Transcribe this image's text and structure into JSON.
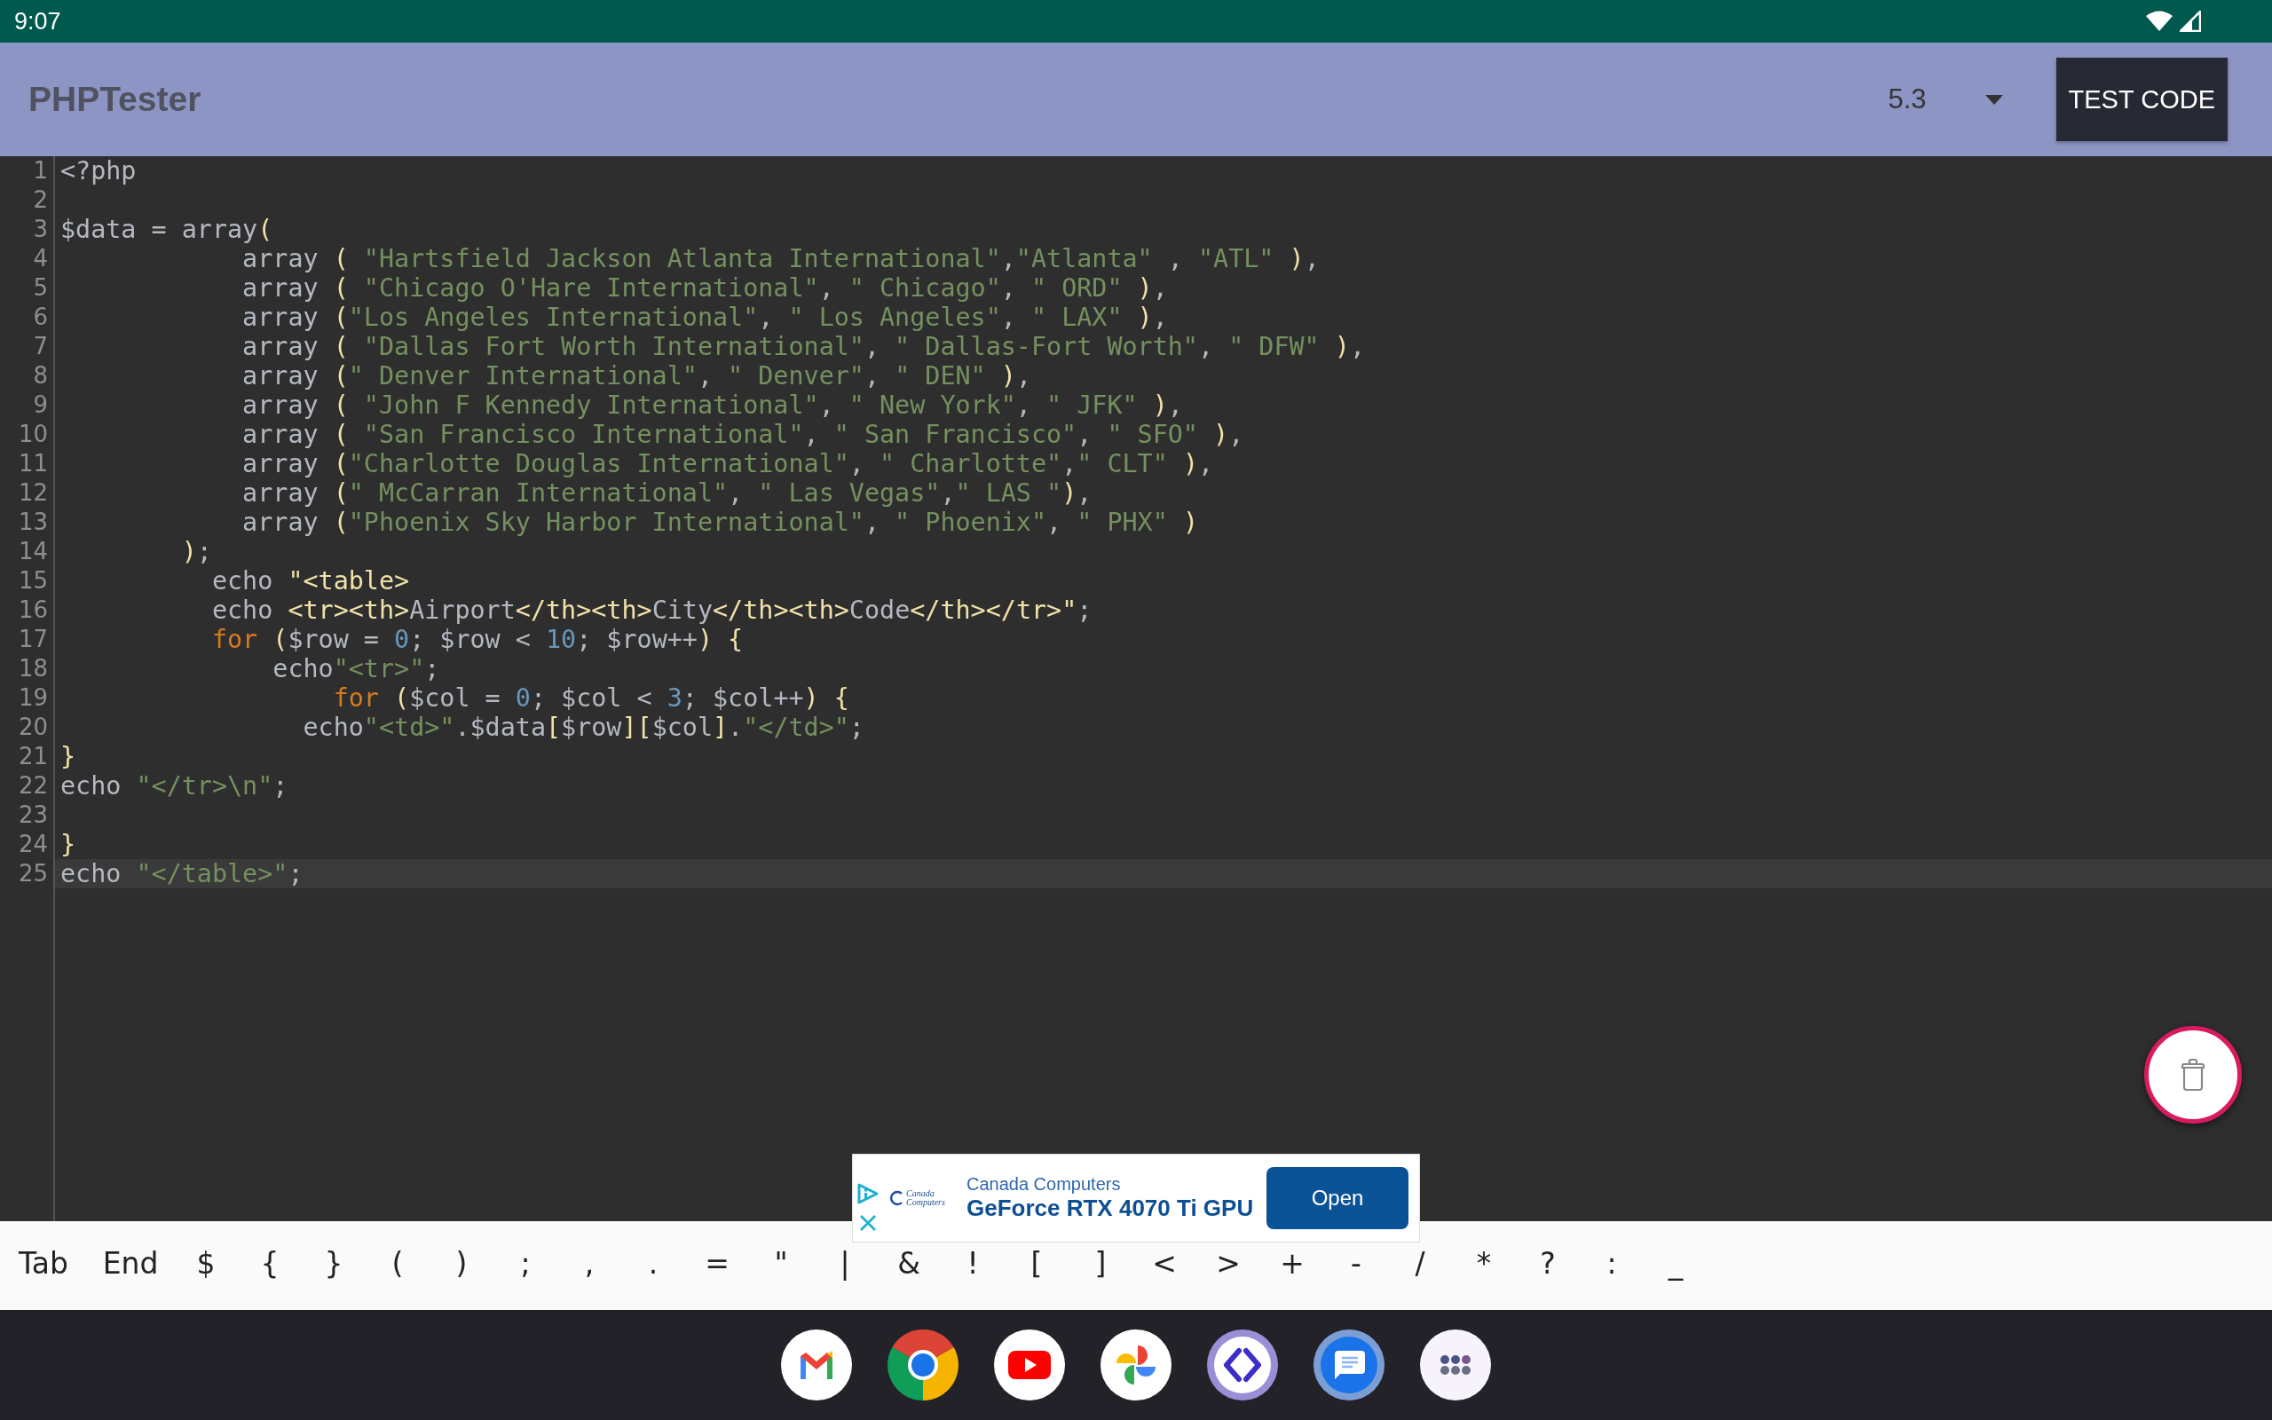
{
  "status_bar": {
    "time": "9:07"
  },
  "app_bar": {
    "title": "PHPTester",
    "version_select": {
      "value": "5.3"
    },
    "action_button": "TEST CODE"
  },
  "editor": {
    "lines": [
      {
        "number": "1",
        "current": false,
        "tokens": [
          {
            "kind": "plain",
            "text": "<?php"
          }
        ]
      },
      {
        "number": "2",
        "current": false
      },
      {
        "number": "3",
        "current": false,
        "tokens": [
          {
            "kind": "plain",
            "text": "$data = array"
          },
          {
            "kind": "punct",
            "text": "("
          }
        ]
      },
      {
        "number": "4",
        "current": false,
        "tokens": [
          {
            "kind": "plain",
            "text": "            array "
          },
          {
            "kind": "punct",
            "text": "( "
          },
          {
            "kind": "string",
            "text": "\"Hartsfield Jackson Atlanta International\""
          },
          {
            "kind": "plain",
            "text": ","
          },
          {
            "kind": "string",
            "text": "\"Atlanta\""
          },
          {
            "kind": "plain",
            "text": " , "
          },
          {
            "kind": "string",
            "text": "\"ATL\""
          },
          {
            "kind": "punct",
            "text": " )"
          },
          {
            "kind": "plain",
            "text": ","
          }
        ]
      },
      {
        "number": "5",
        "current": false,
        "tokens": [
          {
            "kind": "plain",
            "text": "            array "
          },
          {
            "kind": "punct",
            "text": "( "
          },
          {
            "kind": "string",
            "text": "\"Chicago O'Hare International\""
          },
          {
            "kind": "plain",
            "text": ", "
          },
          {
            "kind": "string",
            "text": "\" Chicago\""
          },
          {
            "kind": "plain",
            "text": ", "
          },
          {
            "kind": "string",
            "text": "\" ORD\""
          },
          {
            "kind": "punct",
            "text": " )"
          },
          {
            "kind": "plain",
            "text": ","
          }
        ]
      },
      {
        "number": "6",
        "current": false,
        "tokens": [
          {
            "kind": "plain",
            "text": "            array "
          },
          {
            "kind": "punct",
            "text": "("
          },
          {
            "kind": "string",
            "text": "\"Los Angeles International\""
          },
          {
            "kind": "plain",
            "text": ", "
          },
          {
            "kind": "string",
            "text": "\" Los Angeles\""
          },
          {
            "kind": "plain",
            "text": ", "
          },
          {
            "kind": "string",
            "text": "\" LAX\""
          },
          {
            "kind": "punct",
            "text": " )"
          },
          {
            "kind": "plain",
            "text": ","
          }
        ]
      },
      {
        "number": "7",
        "current": false,
        "tokens": [
          {
            "kind": "plain",
            "text": "            array "
          },
          {
            "kind": "punct",
            "text": "( "
          },
          {
            "kind": "string",
            "text": "\"Dallas Fort Worth International\""
          },
          {
            "kind": "plain",
            "text": ", "
          },
          {
            "kind": "string",
            "text": "\" Dallas-Fort Worth\""
          },
          {
            "kind": "plain",
            "text": ", "
          },
          {
            "kind": "string",
            "text": "\" DFW\""
          },
          {
            "kind": "punct",
            "text": " )"
          },
          {
            "kind": "plain",
            "text": ","
          }
        ]
      },
      {
        "number": "8",
        "current": false,
        "tokens": [
          {
            "kind": "plain",
            "text": "            array "
          },
          {
            "kind": "punct",
            "text": "("
          },
          {
            "kind": "string",
            "text": "\" Denver International\""
          },
          {
            "kind": "plain",
            "text": ", "
          },
          {
            "kind": "string",
            "text": "\" Denver\""
          },
          {
            "kind": "plain",
            "text": ", "
          },
          {
            "kind": "string",
            "text": "\" DEN\""
          },
          {
            "kind": "punct",
            "text": " )"
          },
          {
            "kind": "plain",
            "text": ","
          }
        ]
      },
      {
        "number": "9",
        "current": false,
        "tokens": [
          {
            "kind": "plain",
            "text": "            array "
          },
          {
            "kind": "punct",
            "text": "( "
          },
          {
            "kind": "string",
            "text": "\"John F Kennedy International\""
          },
          {
            "kind": "plain",
            "text": ", "
          },
          {
            "kind": "string",
            "text": "\" New York\""
          },
          {
            "kind": "plain",
            "text": ", "
          },
          {
            "kind": "string",
            "text": "\" JFK\""
          },
          {
            "kind": "punct",
            "text": " )"
          },
          {
            "kind": "plain",
            "text": ","
          }
        ]
      },
      {
        "number": "10",
        "current": false,
        "tokens": [
          {
            "kind": "plain",
            "text": "            array "
          },
          {
            "kind": "punct",
            "text": "( "
          },
          {
            "kind": "string",
            "text": "\"San Francisco International\""
          },
          {
            "kind": "plain",
            "text": ", "
          },
          {
            "kind": "string",
            "text": "\" San Francisco\""
          },
          {
            "kind": "plain",
            "text": ", "
          },
          {
            "kind": "string",
            "text": "\" SFO\""
          },
          {
            "kind": "punct",
            "text": " )"
          },
          {
            "kind": "plain",
            "text": ","
          }
        ]
      },
      {
        "number": "11",
        "current": false,
        "tokens": [
          {
            "kind": "plain",
            "text": "            array "
          },
          {
            "kind": "punct",
            "text": "("
          },
          {
            "kind": "string",
            "text": "\"Charlotte Douglas International\""
          },
          {
            "kind": "plain",
            "text": ", "
          },
          {
            "kind": "string",
            "text": "\" Charlotte\""
          },
          {
            "kind": "plain",
            "text": ","
          },
          {
            "kind": "string",
            "text": "\" CLT\""
          },
          {
            "kind": "punct",
            "text": " )"
          },
          {
            "kind": "plain",
            "text": ","
          }
        ]
      },
      {
        "number": "12",
        "current": false,
        "tokens": [
          {
            "kind": "plain",
            "text": "            array "
          },
          {
            "kind": "punct",
            "text": "("
          },
          {
            "kind": "string",
            "text": "\" McCarran International\""
          },
          {
            "kind": "plain",
            "text": ", "
          },
          {
            "kind": "string",
            "text": "\" Las Vegas\""
          },
          {
            "kind": "plain",
            "text": ","
          },
          {
            "kind": "string",
            "text": "\" LAS \""
          },
          {
            "kind": "punct",
            "text": ")"
          },
          {
            "kind": "plain",
            "text": ","
          }
        ]
      },
      {
        "number": "13",
        "current": false,
        "tokens": [
          {
            "kind": "plain",
            "text": "            array "
          },
          {
            "kind": "punct",
            "text": "("
          },
          {
            "kind": "string",
            "text": "\"Phoenix Sky Harbor International\""
          },
          {
            "kind": "plain",
            "text": ", "
          },
          {
            "kind": "string",
            "text": "\" Phoenix\""
          },
          {
            "kind": "plain",
            "text": ", "
          },
          {
            "kind": "string",
            "text": "\" PHX\""
          },
          {
            "kind": "punct",
            "text": " )"
          }
        ]
      },
      {
        "number": "14",
        "current": false,
        "tokens": [
          {
            "kind": "punct",
            "text": "        )"
          },
          {
            "kind": "plain",
            "text": ";"
          }
        ]
      },
      {
        "number": "15",
        "current": false,
        "tokens": [
          {
            "kind": "plain",
            "text": "          echo "
          },
          {
            "kind": "punct",
            "text": "\"<table>"
          }
        ]
      },
      {
        "number": "16",
        "current": false,
        "tokens": [
          {
            "kind": "plain",
            "text": "          echo "
          },
          {
            "kind": "punct",
            "text": "<tr><th>"
          },
          {
            "kind": "plain",
            "text": "Airport"
          },
          {
            "kind": "punct",
            "text": "</th><th>"
          },
          {
            "kind": "plain",
            "text": "City"
          },
          {
            "kind": "punct",
            "text": "</th><th>"
          },
          {
            "kind": "plain",
            "text": "Code"
          },
          {
            "kind": "punct",
            "text": "</th></tr>\""
          },
          {
            "kind": "plain",
            "text": ";"
          }
        ]
      },
      {
        "number": "17",
        "current": false,
        "tokens": [
          {
            "kind": "keyword",
            "text": "          for "
          },
          {
            "kind": "punct",
            "text": "("
          },
          {
            "kind": "plain",
            "text": "$row = "
          },
          {
            "kind": "number",
            "text": "0"
          },
          {
            "kind": "plain",
            "text": "; $row < "
          },
          {
            "kind": "number",
            "text": "10"
          },
          {
            "kind": "plain",
            "text": "; $row++"
          },
          {
            "kind": "punct",
            "text": ") {"
          }
        ]
      },
      {
        "number": "18",
        "current": false,
        "tokens": [
          {
            "kind": "plain",
            "text": "              echo"
          },
          {
            "kind": "string",
            "text": "\"<tr>\""
          },
          {
            "kind": "plain",
            "text": ";"
          }
        ]
      },
      {
        "number": "19",
        "current": false,
        "tokens": [
          {
            "kind": "keyword",
            "text": "                  for "
          },
          {
            "kind": "punct",
            "text": "("
          },
          {
            "kind": "plain",
            "text": "$col = "
          },
          {
            "kind": "number",
            "text": "0"
          },
          {
            "kind": "plain",
            "text": "; $col < "
          },
          {
            "kind": "number",
            "text": "3"
          },
          {
            "kind": "plain",
            "text": "; $col++"
          },
          {
            "kind": "punct",
            "text": ") {"
          }
        ]
      },
      {
        "number": "20",
        "current": false,
        "tokens": [
          {
            "kind": "plain",
            "text": "                echo"
          },
          {
            "kind": "string",
            "text": "\"<td>\""
          },
          {
            "kind": "plain",
            "text": ".$data"
          },
          {
            "kind": "punct",
            "text": "["
          },
          {
            "kind": "plain",
            "text": "$row"
          },
          {
            "kind": "punct",
            "text": "]["
          },
          {
            "kind": "plain",
            "text": "$col"
          },
          {
            "kind": "punct",
            "text": "]"
          },
          {
            "kind": "plain",
            "text": "."
          },
          {
            "kind": "string",
            "text": "\"</td>\""
          },
          {
            "kind": "plain",
            "text": ";"
          }
        ]
      },
      {
        "number": "21",
        "current": false,
        "tokens": [
          {
            "kind": "punct",
            "text": "}"
          }
        ]
      },
      {
        "number": "22",
        "current": false,
        "tokens": [
          {
            "kind": "plain",
            "text": "echo "
          },
          {
            "kind": "string",
            "text": "\"</tr>\\n\""
          },
          {
            "kind": "plain",
            "text": ";"
          }
        ]
      },
      {
        "number": "23",
        "current": false
      },
      {
        "number": "24",
        "current": false,
        "tokens": [
          {
            "kind": "punct",
            "text": "}"
          }
        ]
      },
      {
        "number": "25",
        "current": true,
        "tokens": [
          {
            "kind": "plain",
            "text": "echo "
          },
          {
            "kind": "string",
            "text": "\"</table>\""
          },
          {
            "kind": "plain",
            "text": ";"
          }
        ]
      }
    ]
  },
  "ad": {
    "logo_text": "Canada Computers",
    "advertiser": "Canada Computers",
    "headline": "GeForce RTX 4070 Ti GPU",
    "button": "Open"
  },
  "keys": [
    "Tab",
    "End",
    "$",
    "{",
    "}",
    "(",
    ")",
    ";",
    ",",
    ".",
    "=",
    "\"",
    "|",
    "&",
    "!",
    "[",
    "]",
    "<",
    ">",
    "+",
    "-",
    "/",
    "*",
    "?",
    ":",
    "_"
  ]
}
